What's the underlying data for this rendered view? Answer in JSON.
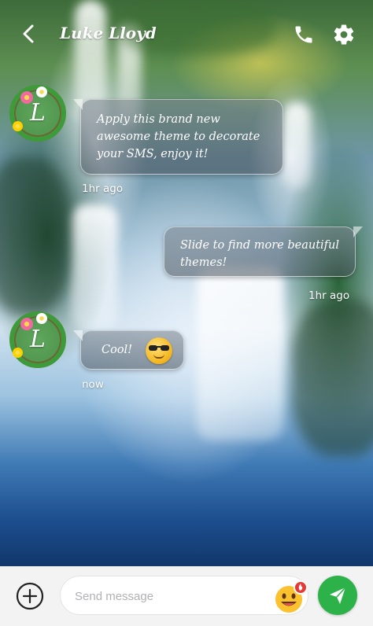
{
  "header": {
    "contact_name": "Luke Lloyd",
    "back_icon": "chevron-left-icon",
    "call_icon": "phone-icon",
    "settings_icon": "gear-icon"
  },
  "contact": {
    "avatar_letter": "L"
  },
  "messages": [
    {
      "direction": "incoming",
      "text": "Apply this brand new awesome theme to decorate your SMS, enjoy it!",
      "time": "1hr ago"
    },
    {
      "direction": "outgoing",
      "text": "Slide to find more beautiful themes!",
      "time": "1hr ago"
    },
    {
      "direction": "incoming",
      "text": "Cool!",
      "emoji": "sunglasses-emoji",
      "time": "now"
    }
  ],
  "composer": {
    "placeholder": "Send message",
    "value": "",
    "add_icon": "plus-circle-icon",
    "emoji_icon": "smiley-emoji-icon",
    "send_icon": "send-arrow-icon"
  },
  "colors": {
    "send_button": "#2db24a",
    "bottom_bar": "#f3f3f4"
  }
}
